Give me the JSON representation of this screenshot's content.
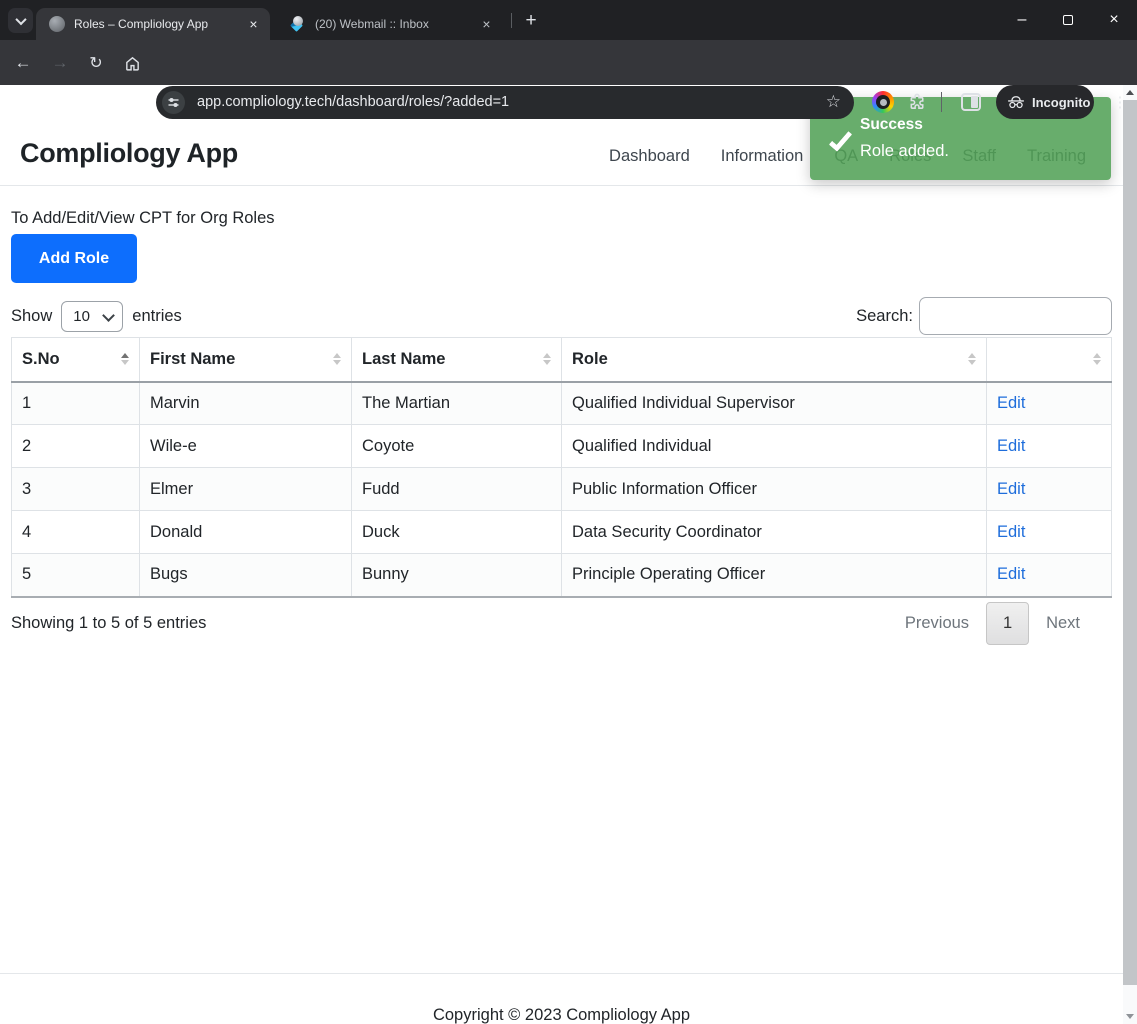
{
  "browser": {
    "tabs": [
      {
        "title": "Roles – Compliology App"
      },
      {
        "title": "(20) Webmail :: Inbox"
      }
    ],
    "url": "app.compliology.tech/dashboard/roles/?added=1",
    "incognito_label": "Incognito"
  },
  "icons": {
    "close": "×",
    "plus": "+",
    "minimize": "–",
    "back": "←",
    "forward": "→",
    "reload": "↻",
    "star": "☆",
    "kebab": "⋮"
  },
  "page": {
    "brand": "Compliology App",
    "nav": {
      "items": [
        "Dashboard",
        "Information",
        "QA",
        "Roles",
        "Staff",
        "Training"
      ]
    },
    "toast": {
      "title": "Success",
      "message": "Role added."
    },
    "intro": "To Add/Edit/View CPT for Org Roles",
    "add_role_label": "Add Role",
    "length_menu": {
      "prefix": "Show",
      "selected": "10",
      "suffix": "entries"
    },
    "search": {
      "label": "Search:",
      "value": ""
    },
    "table": {
      "headers": [
        "S.No",
        "First Name",
        "Last Name",
        "Role",
        ""
      ],
      "rows": [
        {
          "sno": "1",
          "first_name": "Marvin",
          "last_name": "The Martian",
          "role": "Qualified Individual Supervisor",
          "action": "Edit"
        },
        {
          "sno": "2",
          "first_name": "Wile-e",
          "last_name": "Coyote",
          "role": "Qualified Individual",
          "action": "Edit"
        },
        {
          "sno": "3",
          "first_name": "Elmer",
          "last_name": "Fudd",
          "role": "Public Information Officer",
          "action": "Edit"
        },
        {
          "sno": "4",
          "first_name": "Donald",
          "last_name": "Duck",
          "role": "Data Security Coordinator",
          "action": "Edit"
        },
        {
          "sno": "5",
          "first_name": "Bugs",
          "last_name": "Bunny",
          "role": "Principle Operating Officer",
          "action": "Edit"
        }
      ]
    },
    "info_text": "Showing 1 to 5 of 5 entries",
    "pagination": {
      "previous": "Previous",
      "current_page": "1",
      "next": "Next"
    },
    "footer": "Copyright © 2023 Compliology App"
  },
  "colors": {
    "accent_blue": "#0d6efd",
    "toast_green": "#51a156",
    "link_blue": "#1e6ddb"
  }
}
